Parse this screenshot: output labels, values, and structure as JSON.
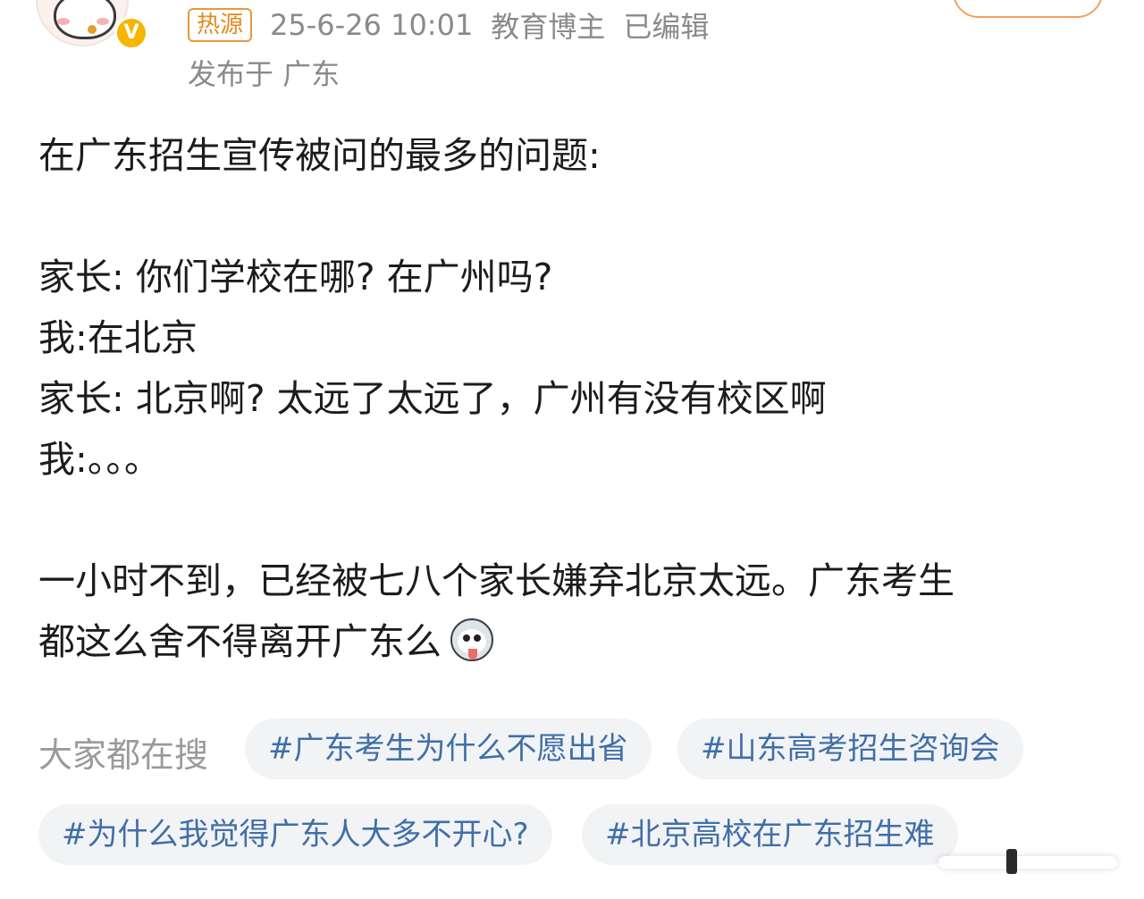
{
  "post_header": {
    "hot_badge": "热源",
    "timestamp": "25-6-26 10:01",
    "author_title": "教育博主",
    "edited": "已编辑",
    "location": "发布于 广东",
    "verified_badge": "V"
  },
  "post_body": {
    "lines": [
      "在广东招生宣传被问的最多的问题:",
      "家长: 你们学校在哪? 在广州吗?",
      "我:在北京",
      "家长: 北京啊? 太远了太远了，广州有没有校区啊",
      "我:。。。",
      "一小时不到，已经被七八个家长嫌弃北京太远。广东考生",
      "都这么舍不得离开广东么"
    ],
    "emoji": "husky-emoji"
  },
  "trending": {
    "label": "大家都在搜",
    "tags": [
      "#广东考生为什么不愿出省",
      "#山东高考招生咨询会",
      "#为什么我觉得广东人大多不开心?",
      "#北京高校在广东招生难"
    ]
  },
  "colors": {
    "tag_text": "#3f6fa8",
    "tag_bg": "#f2f3f5",
    "hot_badge": "#e08a20",
    "meta_text": "#8a8a8a",
    "verified_badge": "#f7b500"
  }
}
